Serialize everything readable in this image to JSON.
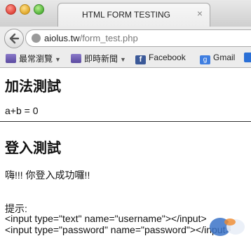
{
  "window": {
    "tab_title": "HTML FORM TESTING",
    "tab_close": "×"
  },
  "toolbar": {
    "url_host": "aiolus.tw",
    "url_path": "/form_test.php"
  },
  "bookmarks": [
    {
      "label": "最常瀏覽",
      "icon": "folder-icon",
      "dropdown": true
    },
    {
      "label": "即時新聞",
      "icon": "folder-icon",
      "dropdown": true
    },
    {
      "label": "Facebook",
      "icon": "facebook-icon"
    },
    {
      "label": "Gmail",
      "icon": "google-icon"
    }
  ],
  "page": {
    "heading1": "加法測試",
    "sum_text": "a+b = 0",
    "heading2": "登入測試",
    "login_msg": "嗨!!! 你登入成功囉!!",
    "hint_label": "提示:",
    "hint_line1": "<input type=\"text\" name=\"username\"></input>",
    "hint_line2": "<input type=\"password\" name=\"password\"></input>"
  },
  "colors": {
    "facebook": "#3b5998",
    "google": "#3f7ee0",
    "folder": "#5b4aa0"
  }
}
